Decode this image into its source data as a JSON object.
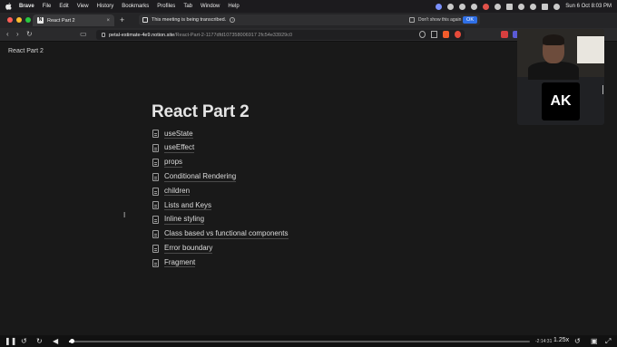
{
  "menubar": {
    "app": "Brave",
    "items": [
      "File",
      "Edit",
      "View",
      "History",
      "Bookmarks",
      "Profiles",
      "Tab",
      "Window",
      "Help"
    ],
    "clock": "Sun 6 Oct  8:03 PM"
  },
  "browser": {
    "tab_title": "React Part 2",
    "tab_favicon": "N",
    "banner_text": "This meeting is being transcribed.",
    "banner_checkbox_label": "Don't show this again",
    "banner_ok": "OK",
    "url_host": "petal-estimate-4e9.notion.site",
    "url_path": "/React-Part-2-1177dfd107358006917 2fc54e33929c0"
  },
  "page": {
    "breadcrumb": "React Part 2",
    "title": "React Part 2",
    "subpages": [
      "useState",
      "useEffect",
      "props",
      "Conditional Rendering",
      "children",
      "Lists and Keys",
      "Inline styling",
      "Class based vs functional components",
      "Error boundary",
      "Fragment"
    ]
  },
  "meeting": {
    "participant_initials": "AK"
  },
  "player": {
    "progress": 0.005,
    "remaining": "-2:14:31",
    "speed": "1.25x"
  },
  "colors": {
    "accent": "#2f6fe6",
    "background": "#191919"
  }
}
